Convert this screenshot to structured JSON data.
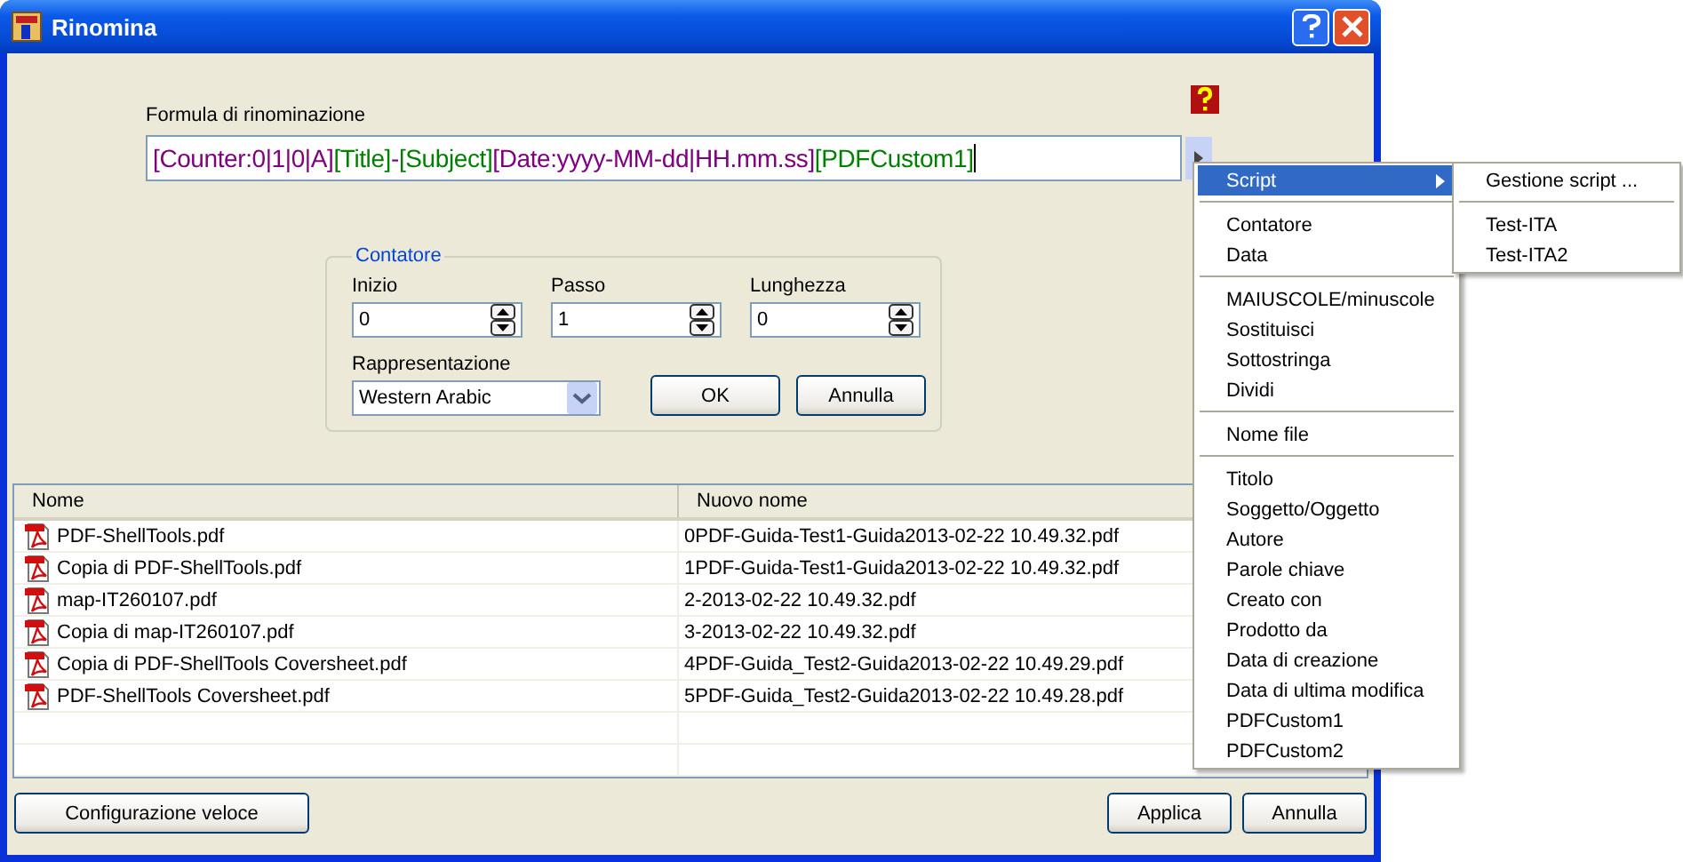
{
  "window": {
    "title": "Rinomina"
  },
  "formula": {
    "label": "Formula di rinominazione",
    "segments": [
      {
        "text": "[Counter:0|1|0|A]",
        "color": "#800080"
      },
      {
        "text": "[Title]",
        "color": "#008000"
      },
      {
        "text": "-",
        "color": "#800080"
      },
      {
        "text": "[Subject]",
        "color": "#008000"
      },
      {
        "text": "[Date:yyyy-MM-dd|HH.mm.ss]",
        "color": "#800080"
      },
      {
        "text": "[PDFCustom1]",
        "color": "#008000"
      }
    ]
  },
  "counter": {
    "title": "Contatore",
    "fields": [
      {
        "label": "Inizio",
        "value": "0"
      },
      {
        "label": "Passo",
        "value": "1"
      },
      {
        "label": "Lunghezza",
        "value": "0"
      }
    ],
    "representation": {
      "label": "Rappresentazione",
      "value": "Western Arabic"
    },
    "ok": "OK",
    "cancel": "Annulla"
  },
  "table": {
    "columns": [
      "Nome",
      "Nuovo nome"
    ],
    "rows": [
      {
        "name": "PDF-ShellTools.pdf",
        "new_name": "0PDF-Guida-Test1-Guida2013-02-22 10.49.32.pdf"
      },
      {
        "name": "Copia di PDF-ShellTools.pdf",
        "new_name": "1PDF-Guida-Test1-Guida2013-02-22 10.49.32.pdf"
      },
      {
        "name": "map-IT260107.pdf",
        "new_name": "2-2013-02-22 10.49.32.pdf"
      },
      {
        "name": "Copia di map-IT260107.pdf",
        "new_name": "3-2013-02-22 10.49.32.pdf"
      },
      {
        "name": "Copia di PDF-ShellTools Coversheet.pdf",
        "new_name": "4PDF-Guida_Test2-Guida2013-02-22 10.49.29.pdf"
      },
      {
        "name": "PDF-ShellTools Coversheet.pdf",
        "new_name": "5PDF-Guida_Test2-Guida2013-02-22 10.49.28.pdf"
      }
    ]
  },
  "buttons": {
    "quick_config": "Configurazione veloce",
    "apply": "Applica",
    "cancel": "Annulla"
  },
  "menu": {
    "groups": [
      [
        {
          "label": "Script",
          "submenu": true,
          "selected": true
        }
      ],
      [
        {
          "label": "Contatore",
          "submenu": false,
          "selected": false
        },
        {
          "label": "Data",
          "submenu": false,
          "selected": false
        }
      ],
      [
        {
          "label": "MAIUSCOLE/minuscole",
          "submenu": false,
          "selected": false
        },
        {
          "label": "Sostituisci",
          "submenu": false,
          "selected": false
        },
        {
          "label": "Sottostringa",
          "submenu": false,
          "selected": false
        },
        {
          "label": "Dividi",
          "submenu": false,
          "selected": false
        }
      ],
      [
        {
          "label": "Nome file",
          "submenu": false,
          "selected": false
        }
      ],
      [
        {
          "label": "Titolo",
          "submenu": false,
          "selected": false
        },
        {
          "label": "Soggetto/Oggetto",
          "submenu": false,
          "selected": false
        },
        {
          "label": "Autore",
          "submenu": false,
          "selected": false
        },
        {
          "label": "Parole chiave",
          "submenu": false,
          "selected": false
        },
        {
          "label": "Creato con",
          "submenu": false,
          "selected": false
        },
        {
          "label": "Prodotto da",
          "submenu": false,
          "selected": false
        },
        {
          "label": "Data di creazione",
          "submenu": false,
          "selected": false
        },
        {
          "label": "Data di ultima modifica",
          "submenu": false,
          "selected": false
        },
        {
          "label": "PDFCustom1",
          "submenu": false,
          "selected": false
        },
        {
          "label": "PDFCustom2",
          "submenu": false,
          "selected": false
        }
      ]
    ]
  },
  "submenu": {
    "groups": [
      [
        "Gestione script ..."
      ],
      [
        "Test-ITA",
        "Test-ITA2"
      ]
    ]
  }
}
